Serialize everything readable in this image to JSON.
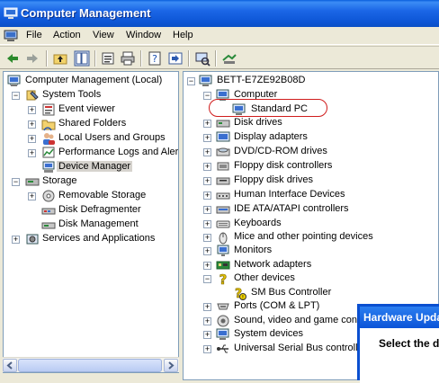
{
  "window": {
    "title": "Computer Management"
  },
  "menu": [
    {
      "label": "File"
    },
    {
      "label": "Action"
    },
    {
      "label": "View"
    },
    {
      "label": "Window"
    },
    {
      "label": "Help"
    }
  ],
  "left_tree": {
    "root": "Computer Management (Local)",
    "system_tools": "System Tools",
    "event_viewer": "Event viewer",
    "shared_folders": "Shared Folders",
    "local_users": "Local Users and Groups",
    "perf_logs": "Performance Logs and Alerts",
    "device_manager": "Device Manager",
    "storage": "Storage",
    "removable_storage": "Removable Storage",
    "disk_defrag": "Disk Defragmenter",
    "disk_mgmt": "Disk Management",
    "services": "Services and Applications"
  },
  "device_tree": {
    "root": "BETT-E7ZE92B08D",
    "computer": "Computer",
    "standard_pc": "Standard PC",
    "categories": [
      "Disk drives",
      "Display adapters",
      "DVD/CD-ROM drives",
      "Floppy disk controllers",
      "Floppy disk drives",
      "Human Interface Devices",
      "IDE ATA/ATAPI controllers",
      "Keyboards",
      "Mice and other pointing devices",
      "Monitors",
      "Network adapters"
    ],
    "other_devices": "Other devices",
    "sm_bus": "SM Bus Controller",
    "more_categories": [
      "Ports (COM & LPT)",
      "Sound, video and game controllers",
      "System devices",
      "Universal Serial Bus controllers"
    ]
  },
  "dialog": {
    "title": "Hardware Update Wizard",
    "text": "Select the device"
  },
  "colors": {
    "title_bar": "#1b66e6",
    "highlight_ring": "#d01c1c",
    "pane_border": "#7f9db9",
    "window_bg": "#ece9d8"
  }
}
